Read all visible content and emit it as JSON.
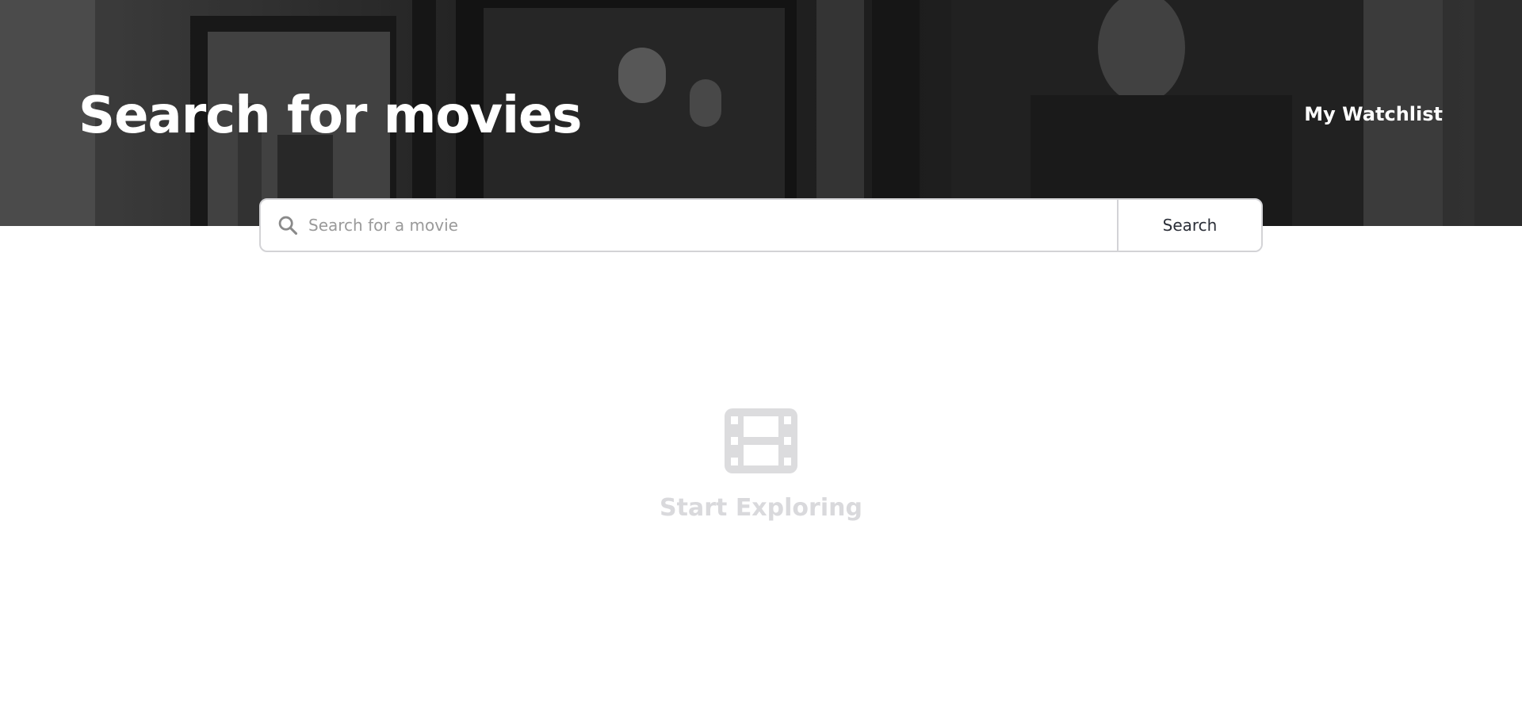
{
  "header": {
    "title": "Search for movies",
    "watchlist_link": "My Watchlist",
    "background": "movie-posters-backdrop"
  },
  "search": {
    "placeholder": "Search for a movie",
    "value": "",
    "button_label": "Search",
    "icon": "search-icon"
  },
  "empty_state": {
    "icon": "film-icon",
    "text": "Start Exploring"
  },
  "colors": {
    "title": "#ffffff",
    "empty_text": "#d9d9dc",
    "empty_icon": "#dcdcde",
    "border": "#d3d3d6",
    "button_text": "#2b2f38"
  }
}
